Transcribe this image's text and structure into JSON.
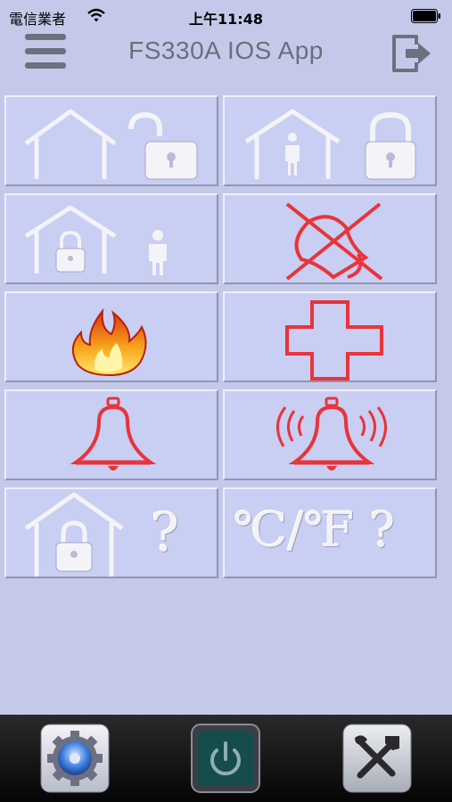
{
  "status_bar": {
    "carrier": "電信業者",
    "time": "上午11:48"
  },
  "header": {
    "title": "FS330A IOS App",
    "left_icon": "hamburger-menu-icon",
    "right_icon": "exit-icon"
  },
  "grid": {
    "tiles": [
      {
        "icon": "home-unlocked-icon"
      },
      {
        "icon": "home-person-locked-icon"
      },
      {
        "icon": "home-locked-person-out-icon"
      },
      {
        "icon": "bell-muted-icon"
      },
      {
        "icon": "fire-icon"
      },
      {
        "icon": "medical-cross-icon"
      },
      {
        "icon": "bell-icon"
      },
      {
        "icon": "bell-ringing-icon"
      },
      {
        "icon": "home-lock-status-icon",
        "text": "?"
      },
      {
        "icon": "temperature-icon",
        "text": "℃/℉ ?"
      }
    ]
  },
  "tab_bar": {
    "items": [
      {
        "icon": "settings-gear-icon"
      },
      {
        "icon": "power-icon"
      },
      {
        "icon": "tools-icon"
      }
    ]
  },
  "colors": {
    "background": "#c5c9e9",
    "tile": "#c9cef3",
    "alert_red": "#e8343a",
    "tab_bar": "#111111"
  }
}
